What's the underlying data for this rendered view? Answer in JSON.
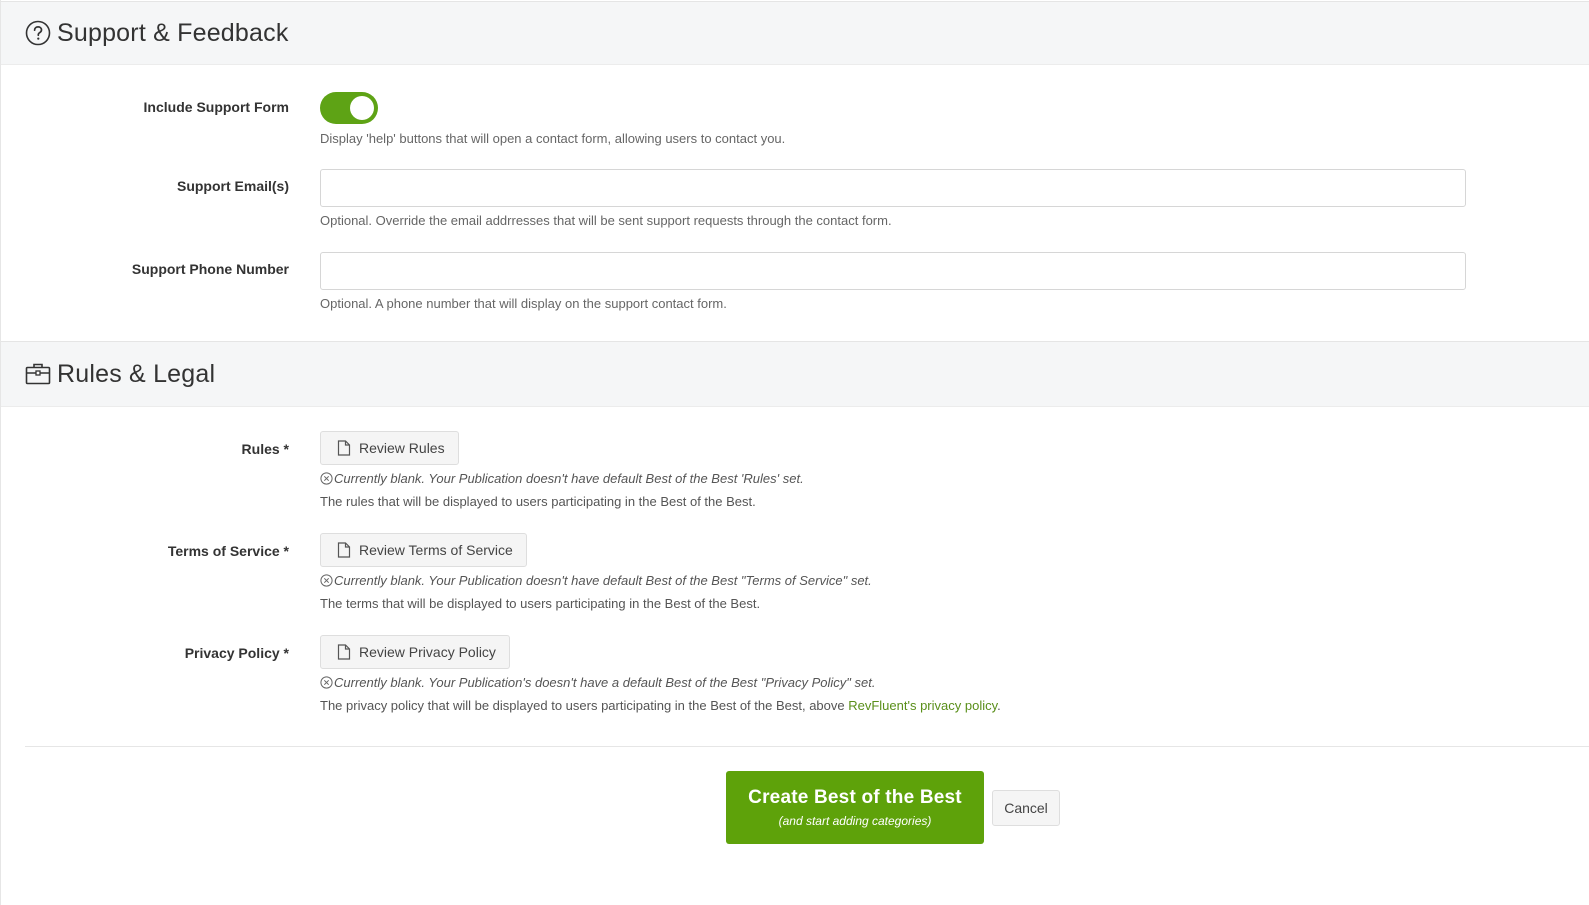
{
  "support_section": {
    "title": "Support & Feedback",
    "icon": "question-circle-icon",
    "include_form": {
      "label": "Include Support Form",
      "enabled": true,
      "help": "Display 'help' buttons that will open a contact form, allowing users to contact you."
    },
    "emails": {
      "label": "Support Email(s)",
      "value": "",
      "help": "Optional. Override the email addrresses that will be sent support requests through the contact form."
    },
    "phone": {
      "label": "Support Phone Number",
      "value": "",
      "help": "Optional. A phone number that will display on the support contact form."
    }
  },
  "rules_section": {
    "title": "Rules & Legal",
    "icon": "briefcase-icon",
    "rules": {
      "label": "Rules *",
      "button": "Review Rules",
      "blank_note": "Currently blank. Your Publication doesn't have default Best of the Best 'Rules' set.",
      "desc": "The rules that will be displayed to users participating in the Best of the Best."
    },
    "terms": {
      "label": "Terms of Service *",
      "button": "Review Terms of Service",
      "blank_note": "Currently blank. Your Publication doesn't have default Best of the Best \"Terms of Service\" set.",
      "desc": "The terms that will be displayed to users participating in the Best of the Best."
    },
    "privacy": {
      "label": "Privacy Policy *",
      "button": "Review Privacy Policy",
      "blank_note": "Currently blank. Your Publication's doesn't have a default Best of the Best \"Privacy Policy\" set.",
      "desc_prefix": "The privacy policy that will be displayed to users participating in the Best of the Best, above ",
      "desc_link": "RevFluent's privacy policy",
      "desc_suffix": "."
    }
  },
  "actions": {
    "create_label": "Create Best of the Best",
    "create_sub": "(and start adding categories)",
    "cancel_label": "Cancel"
  },
  "colors": {
    "accent_green": "#5ea20a",
    "link_green": "#5a8f1a",
    "header_bg": "#f5f6f7"
  }
}
